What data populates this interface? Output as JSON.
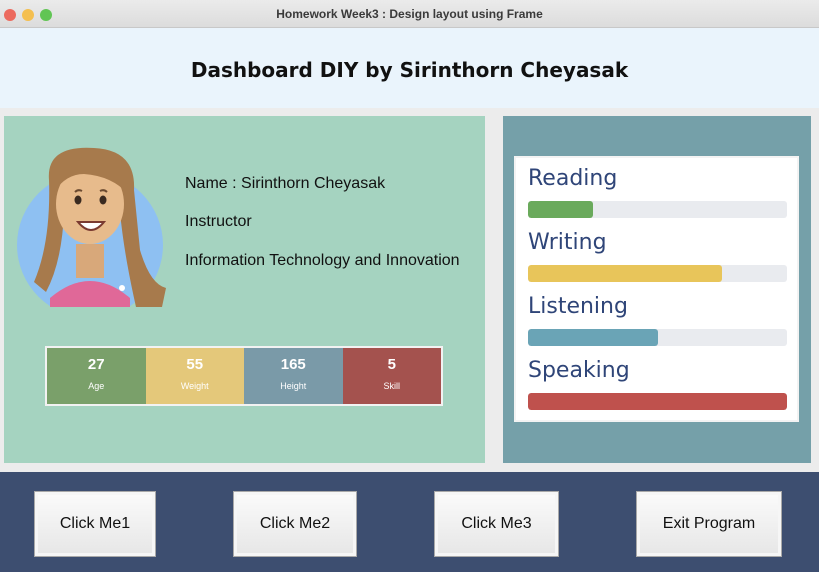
{
  "window": {
    "title": "Homework Week3 : Design layout using Frame"
  },
  "header": {
    "title": "Dashboard DIY by Sirinthorn Cheyasak"
  },
  "profile": {
    "name_line": "Name : Sirinthorn Cheyasak",
    "role": "Instructor",
    "department": "Information Technology and Innovation",
    "avatar_icon": "girl-avatar-icon"
  },
  "stats": [
    {
      "value": "27",
      "label": "Age",
      "color": "#7aa06a"
    },
    {
      "value": "55",
      "label": "Weight",
      "color": "#e4c87a"
    },
    {
      "value": "165",
      "label": "Height",
      "color": "#7a9aa8"
    },
    {
      "value": "5",
      "label": "Skill",
      "color": "#a4524e"
    }
  ],
  "skills": [
    {
      "label": "Reading",
      "level": 0.25,
      "color": "#6aaa5c"
    },
    {
      "label": "Writing",
      "level": 0.75,
      "color": "#e8c55a"
    },
    {
      "label": "Listening",
      "level": 0.5,
      "color": "#6aa4b6"
    },
    {
      "label": "Speaking",
      "level": 1.0,
      "color": "#bf514d"
    }
  ],
  "buttons": {
    "b1": "Click Me1",
    "b2": "Click Me2",
    "b3": "Click Me3",
    "exit": "Exit Program"
  }
}
